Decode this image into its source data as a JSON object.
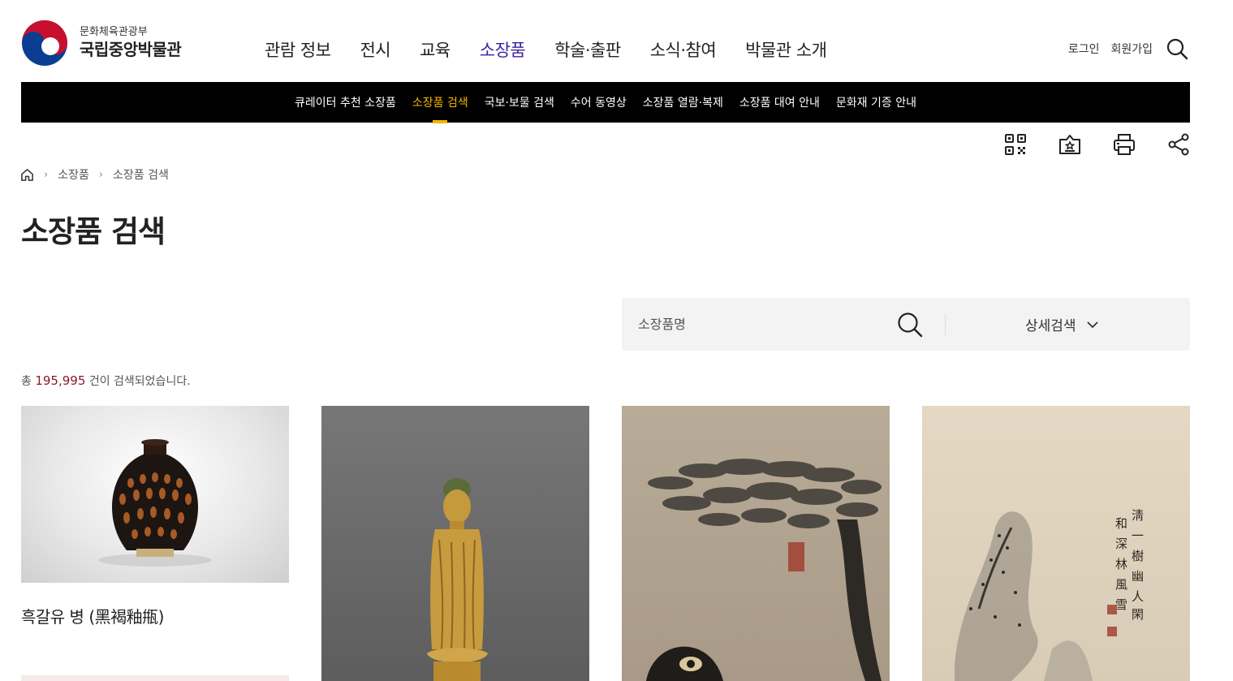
{
  "header": {
    "logo_sub": "문화체육관광부",
    "logo_main": "국립중앙박물관",
    "gnb": [
      "관람 정보",
      "전시",
      "교육",
      "소장품",
      "학술·출판",
      "소식·참여",
      "박물관 소개"
    ],
    "gnb_active_index": 3,
    "login": "로그인",
    "signup": "회원가입"
  },
  "subnav": {
    "items": [
      "큐레이터 추천 소장품",
      "소장품 검색",
      "국보·보물 검색",
      "수어 동영상",
      "소장품 열람·복제",
      "소장품 대여 안내",
      "문화재 기증 안내"
    ],
    "active_index": 1
  },
  "tools": [
    "qr-code-icon",
    "bookmark-icon",
    "print-icon",
    "share-icon"
  ],
  "breadcrumb": {
    "home_icon": "home-icon",
    "items": [
      "소장품",
      "소장품 검색"
    ]
  },
  "page_title": "소장품 검색",
  "search": {
    "placeholder": "소장품명",
    "value": "",
    "advanced_label": "상세검색"
  },
  "results": {
    "prefix": "총",
    "count": "195,995",
    "suffix": "건이 검색되었습니다."
  },
  "cards": [
    {
      "title": "흑갈유 병 (黑褐釉甁)"
    },
    {
      "title": ""
    },
    {
      "title": ""
    },
    {
      "title": ""
    }
  ],
  "colors": {
    "accent_purple": "#3d1fa3",
    "subnav_active": "#f4b400",
    "count_red": "#8b1a2b"
  }
}
